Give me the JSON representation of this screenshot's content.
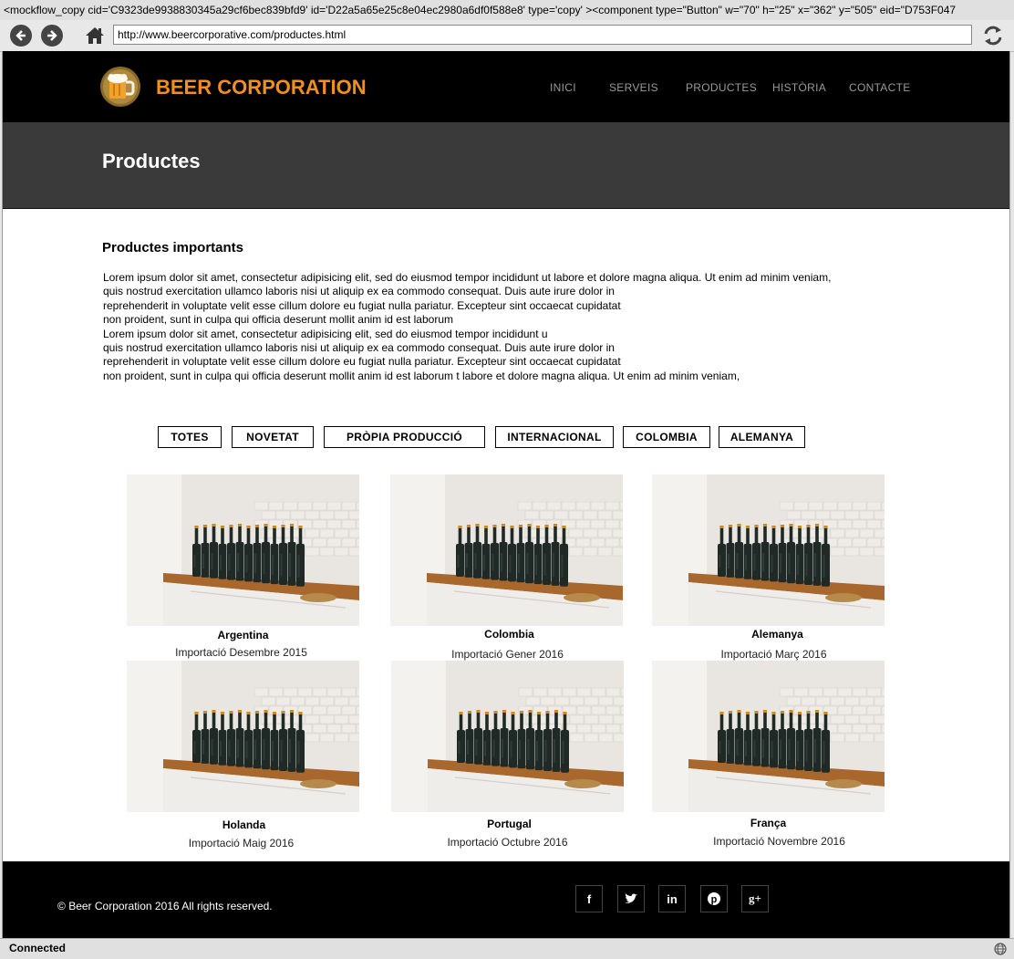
{
  "window": {
    "title": "<mockflow_copy cid='C9323de9938830345a29cf6bec839bfd9' id='D22a5a65e25c8e04ec2980a6df0f588e8' type='copy' ><component type=\"Button\" w=\"70\" h=\"25\" x=\"362\" y=\"505\" eid=\"D753F047"
  },
  "browser": {
    "url": "http://www.beercorporative.com/productes.html",
    "status": "Connected"
  },
  "header": {
    "brand": "BEER CORPORATION",
    "menu": [
      {
        "label": "INICI"
      },
      {
        "label": "SERVEIS"
      },
      {
        "label": "PRODUCTES"
      },
      {
        "label": "HISTÒRIA"
      },
      {
        "label": "CONTACTE"
      }
    ]
  },
  "banner": {
    "title": "Productes"
  },
  "main": {
    "section_title": "Productes importants",
    "lorem_lines": [
      "Lorem ipsum dolor sit amet, consectetur adipisicing elit, sed do eiusmod tempor incididunt ut labore et dolore magna aliqua. Ut enim ad minim veniam,",
      "quis nostrud exercitation ullamco laboris nisi ut aliquip ex ea commodo consequat. Duis aute irure dolor in",
      "reprehenderit in voluptate velit esse cillum dolore eu fugiat nulla pariatur. Excepteur sint occaecat cupidatat",
      "non proident, sunt in culpa qui officia deserunt mollit anim id est laborum",
      "Lorem ipsum dolor sit amet, consectetur adipisicing elit, sed do eiusmod tempor incididunt u",
      "quis nostrud exercitation ullamco laboris nisi ut aliquip ex ea commodo consequat. Duis aute irure dolor in",
      "reprehenderit in voluptate velit esse cillum dolore eu fugiat nulla pariatur. Excepteur sint occaecat cupidatat",
      "non proident, sunt in culpa qui officia deserunt mollit anim id est laborum t labore et dolore magna aliqua. Ut enim ad minim veniam,"
    ],
    "filters": [
      "TOTES",
      "NOVETAT",
      "PRÒPIA PRODUCCIÓ",
      "INTERNACIONAL",
      "COLOMBIA",
      "ALEMANYA"
    ],
    "products": [
      {
        "name": "Argentina",
        "subtitle": "Importació Desembre 2015"
      },
      {
        "name": "Colombia",
        "subtitle": "Importació Gener 2016"
      },
      {
        "name": "Alemanya",
        "subtitle": "Importació Març 2016"
      },
      {
        "name": "Holanda",
        "subtitle": "Importació Maig 2016"
      },
      {
        "name": "Portugal",
        "subtitle": "Importació Octubre 2016"
      },
      {
        "name": "França",
        "subtitle": "Importació Novembre 2016"
      }
    ]
  },
  "footer": {
    "copyright": "Beer Corporation 2016 All rights reserved.",
    "social_icons": [
      "facebook-icon",
      "twitter-icon",
      "linkedin-icon",
      "pinterest-icon",
      "google-plus-icon"
    ]
  },
  "colors": {
    "brand": "#f0901e",
    "header_bg": "#000000",
    "banner_bg": "#3a3a3a"
  }
}
